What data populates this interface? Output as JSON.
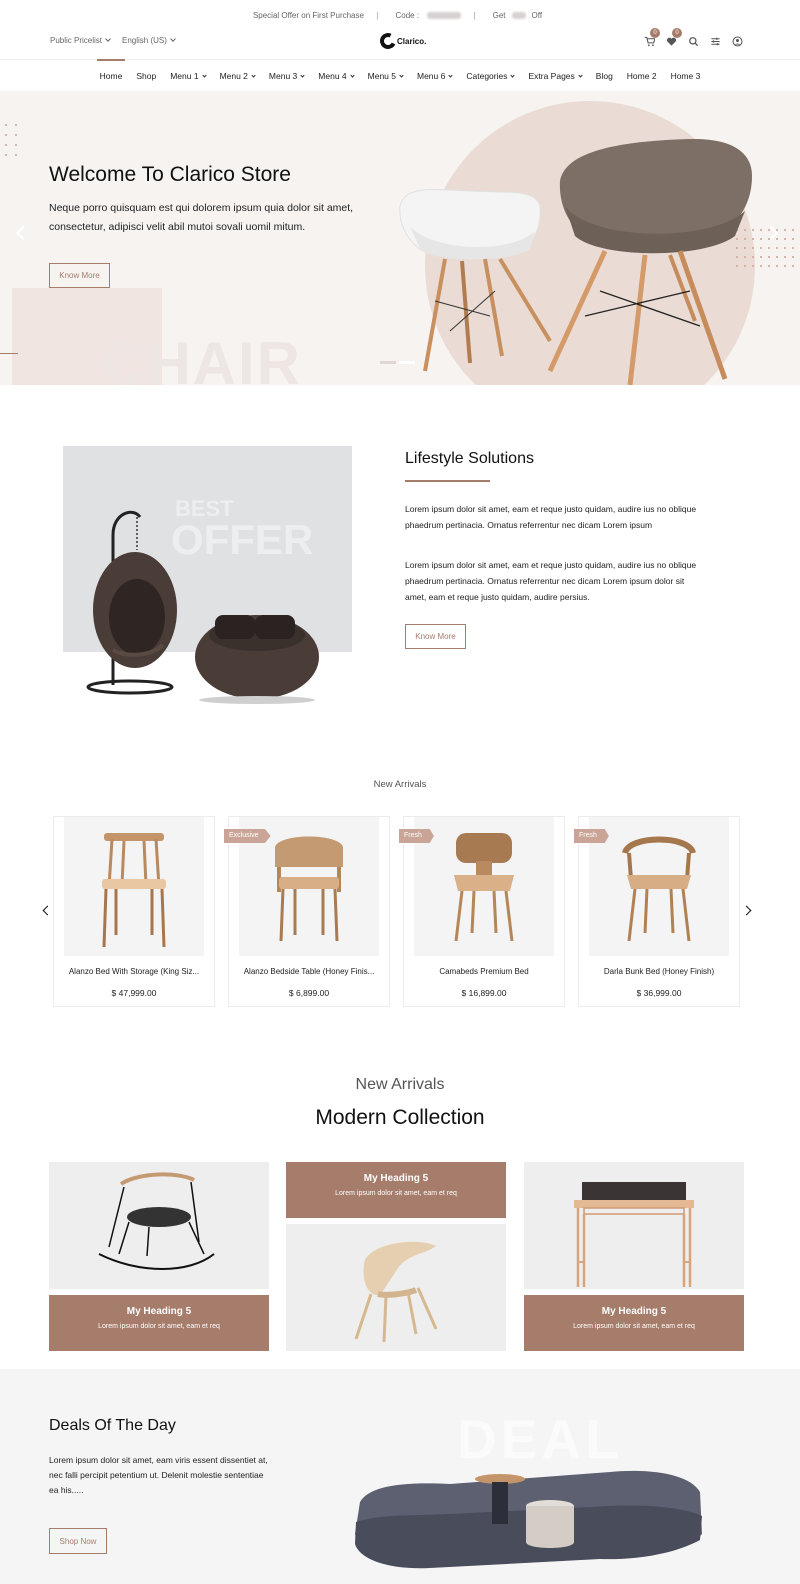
{
  "topbar": {
    "offer": "Special Offer on First Purchase",
    "code_label": "Code :",
    "get_label": "Get",
    "off_label": "Off",
    "separator": "|"
  },
  "header": {
    "pricelist": "Public Pricelist",
    "language": "English (US)",
    "logo_text": "Clarico.",
    "cart_count": "0",
    "wishlist_count": "0"
  },
  "nav": {
    "items": [
      "Home",
      "Shop",
      "Menu 1",
      "Menu 2",
      "Menu 3",
      "Menu 4",
      "Menu 5",
      "Menu 6",
      "Categories",
      "Extra Pages",
      "Blog",
      "Home 2",
      "Home 3"
    ]
  },
  "hero": {
    "title": "Welcome To Clarico Store",
    "description": "Neque porro quisquam est qui dolorem ipsum quia dolor sit amet, consectetur, adipisci velit abil mutoi sovali uomil mitum.",
    "button": "Know More",
    "bg_word": "CHAIR"
  },
  "lifestyle": {
    "image_word_1": "BEST",
    "image_word_2": "OFFER",
    "title": "Lifestyle Solutions",
    "para1": "Lorem ipsum dolor sit amet, eam et reque justo quidam, audire ius no oblique phaedrum pertinacia. Ornatus referrentur nec dicam Lorem ipsum",
    "para2": "Lorem ipsum dolor sit amet, eam et reque justo quidam, audire ius no oblique phaedrum pertinacia. Ornatus referrentur nec dicam Lorem ipsum dolor sit amet, eam et reque justo quidam, audire persius.",
    "button": "Know More"
  },
  "arrivals": {
    "label": "New Arrivals",
    "products": [
      {
        "name": "Alanzo Bed With Storage (King Siz...",
        "price": "$ 47,999.00",
        "tag": ""
      },
      {
        "name": "Alanzo Bedside Table (Honey Finis...",
        "price": "$ 6,899.00",
        "tag": "Exclusive"
      },
      {
        "name": "Camabeds Premium Bed",
        "price": "$ 16,899.00",
        "tag": "Fresh"
      },
      {
        "name": "Darla Bunk Bed (Honey Finish)",
        "price": "$ 36,999.00",
        "tag": "Fresh"
      }
    ]
  },
  "collection": {
    "subtitle": "New Arrivals",
    "title": "Modern Collection",
    "tiles": [
      {
        "heading": "My Heading 5",
        "text": "Lorem ipsum dolor sit amet, eam et req"
      },
      {
        "heading": "My Heading 5",
        "text": "Lorem ipsum dolor sit amet, eam et req"
      },
      {
        "heading": "My Heading 5",
        "text": "Lorem ipsum dolor sit amet, eam et req"
      }
    ]
  },
  "deals": {
    "bg_word": "DEAL",
    "title": "Deals Of The Day",
    "description": "Lorem ipsum dolor sit amet, eam viris essent dissentiet at, nec falli percipit petentium ut. Delenit molestie sententiae ea his.....",
    "button": "Shop Now"
  },
  "colors": {
    "accent": "#a67c6b",
    "hero_bg": "#f6f3f1",
    "offer_bg": "#dfe1e3"
  }
}
